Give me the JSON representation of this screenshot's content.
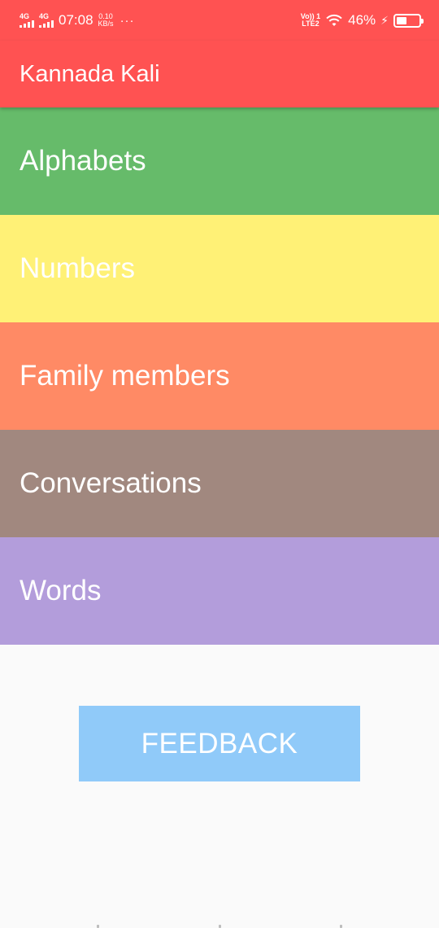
{
  "status_bar": {
    "network_1": "4G",
    "network_2": "4G",
    "time": "07:08",
    "speed_value": "0.10",
    "speed_unit": "KB/s",
    "overflow": "···",
    "volte_top": "Vo)) 1",
    "volte_bottom": "LTE2",
    "wifi_icon": "wifi-icon",
    "battery_percent": "46%",
    "battery_level": 0.46,
    "charging_icon": "charging-bolt-icon"
  },
  "app_bar": {
    "title": "Kannada Kali"
  },
  "categories": [
    {
      "label": "Alphabets",
      "color": "#66bb6a"
    },
    {
      "label": "Numbers",
      "color": "#fff176"
    },
    {
      "label": "Family members",
      "color": "#ff8a65"
    },
    {
      "label": "Conversations",
      "color": "#a1887f"
    },
    {
      "label": "Words",
      "color": "#b39ddb"
    }
  ],
  "feedback_button": {
    "label": "FEEDBACK",
    "color": "#90caf9"
  },
  "colors": {
    "primary": "#ff5252",
    "background": "#fafafa"
  }
}
